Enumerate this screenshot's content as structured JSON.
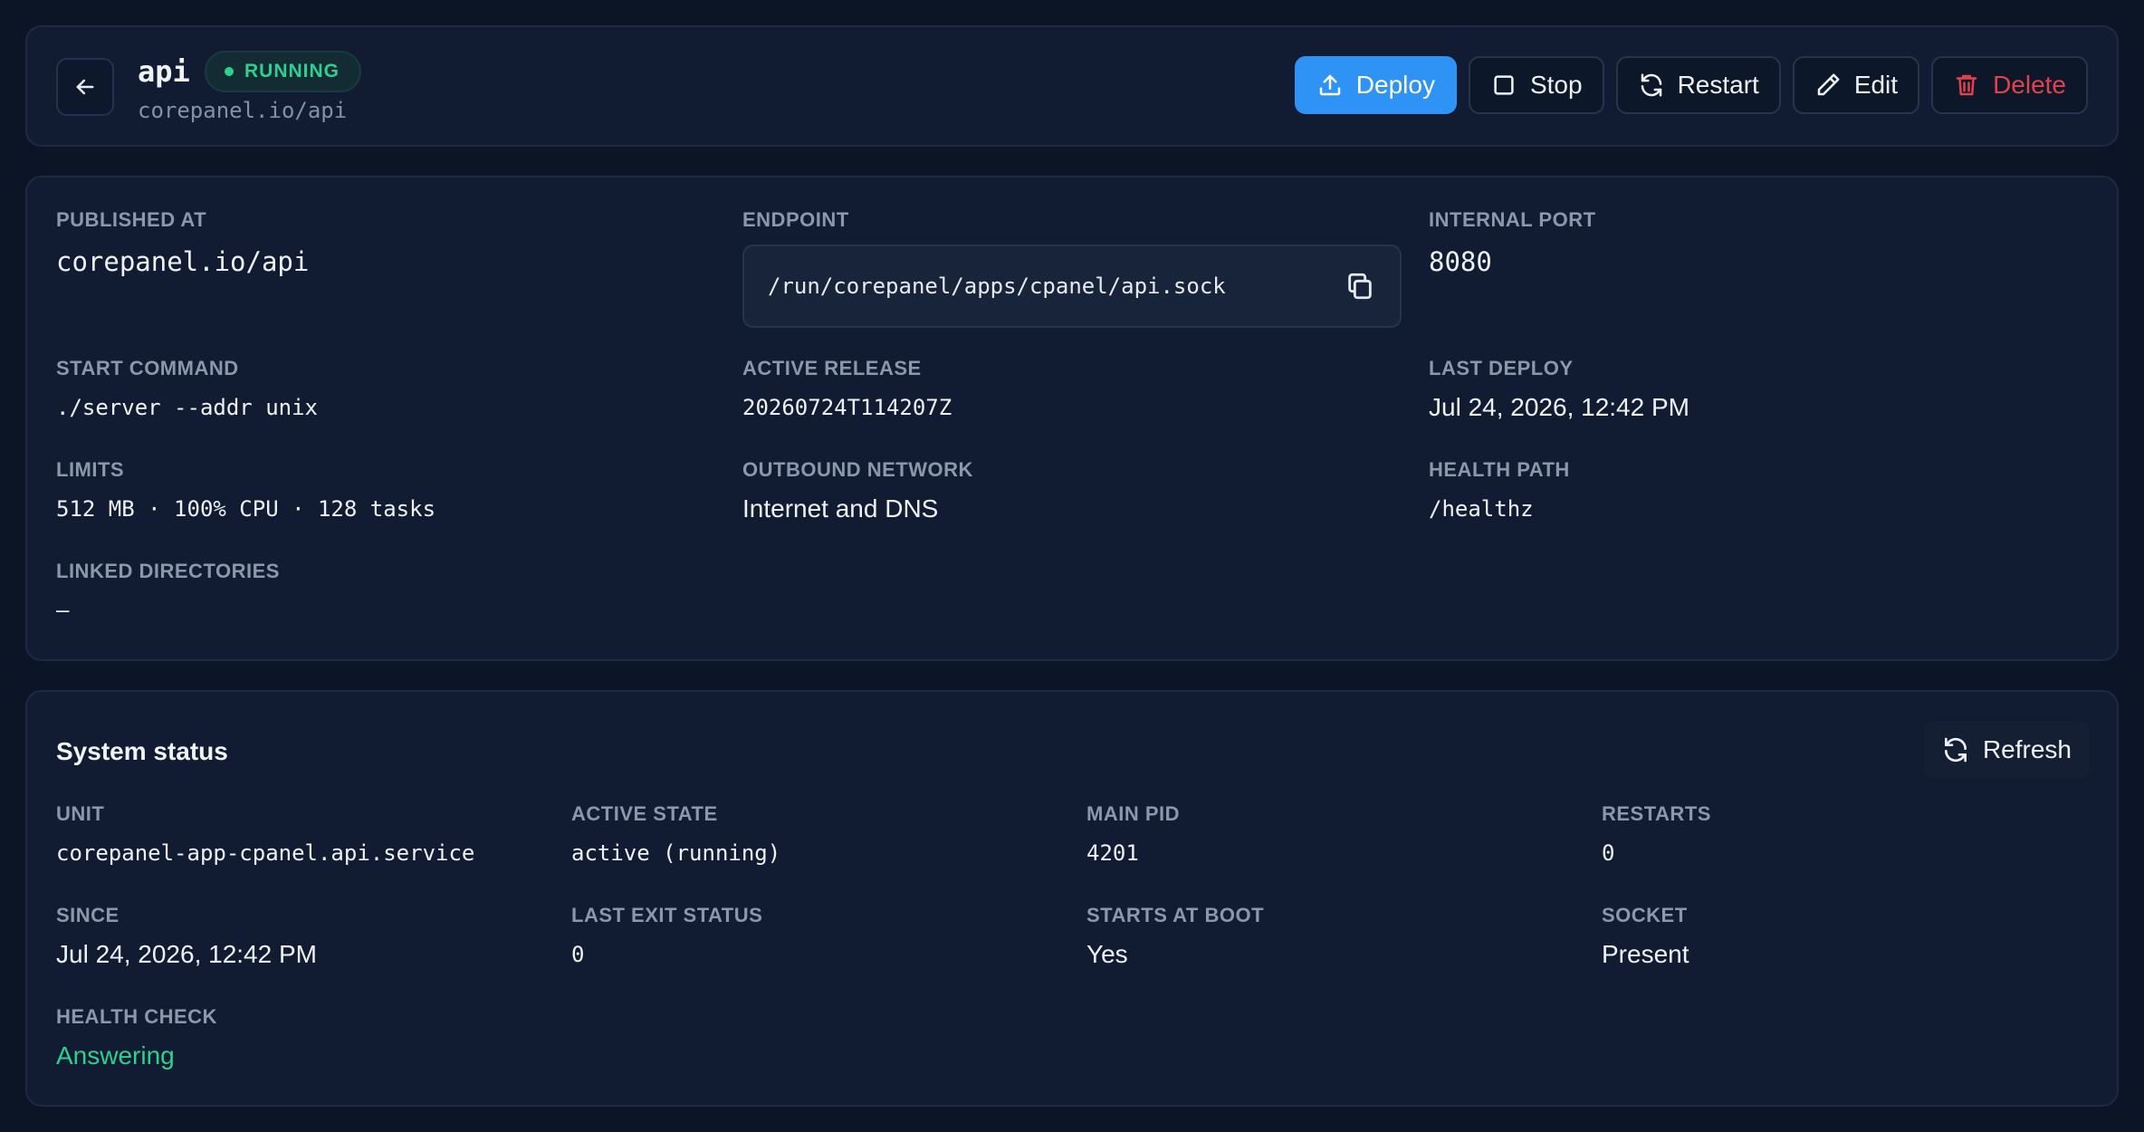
{
  "header": {
    "app_name": "api",
    "status": "RUNNING",
    "url": "corepanel.io/api",
    "actions": {
      "deploy": "Deploy",
      "stop": "Stop",
      "restart": "Restart",
      "edit": "Edit",
      "delete": "Delete"
    }
  },
  "details": {
    "published_at": {
      "label": "PUBLISHED AT",
      "value": "corepanel.io/api"
    },
    "endpoint": {
      "label": "ENDPOINT",
      "value": "/run/corepanel/apps/cpanel/api.sock"
    },
    "internal_port": {
      "label": "INTERNAL PORT",
      "value": "8080"
    },
    "start_command": {
      "label": "START COMMAND",
      "value": "./server --addr unix"
    },
    "active_release": {
      "label": "ACTIVE RELEASE",
      "value": "20260724T114207Z"
    },
    "last_deploy": {
      "label": "LAST DEPLOY",
      "value": "Jul 24, 2026, 12:42 PM"
    },
    "limits": {
      "label": "LIMITS",
      "value": "512 MB · 100% CPU · 128 tasks"
    },
    "outbound_network": {
      "label": "OUTBOUND NETWORK",
      "value": "Internet and DNS"
    },
    "health_path": {
      "label": "HEALTH PATH",
      "value": "/healthz"
    },
    "linked_directories": {
      "label": "LINKED DIRECTORIES",
      "value": "—"
    }
  },
  "system": {
    "title": "System status",
    "refresh": "Refresh",
    "unit": {
      "label": "UNIT",
      "value": "corepanel-app-cpanel.api.service"
    },
    "active_state": {
      "label": "ACTIVE STATE",
      "value": "active (running)"
    },
    "main_pid": {
      "label": "MAIN PID",
      "value": "4201"
    },
    "restarts": {
      "label": "RESTARTS",
      "value": "0"
    },
    "since": {
      "label": "SINCE",
      "value": "Jul 24, 2026, 12:42 PM"
    },
    "last_exit_status": {
      "label": "LAST EXIT STATUS",
      "value": "0"
    },
    "starts_at_boot": {
      "label": "STARTS AT BOOT",
      "value": "Yes"
    },
    "socket": {
      "label": "SOCKET",
      "value": "Present"
    },
    "health_check": {
      "label": "HEALTH CHECK",
      "value": "Answering"
    }
  },
  "colors": {
    "background": "#0c1526",
    "card": "#111c33",
    "accent": "#2f93f5",
    "success": "#2fcf8e",
    "danger": "#e2424b"
  },
  "icons": [
    "arrow-left-icon",
    "upload-icon",
    "square-icon",
    "refresh-icon",
    "pencil-icon",
    "trash-icon",
    "copy-icon"
  ]
}
